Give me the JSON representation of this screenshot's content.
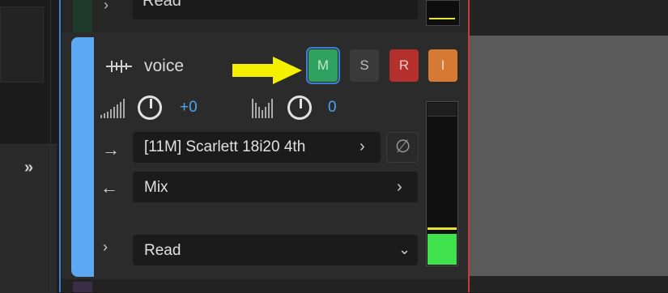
{
  "colors": {
    "track": "#5ea7f2",
    "mute_active": "#2fa25f",
    "record": "#b3302c",
    "input_monitor": "#d67a33",
    "value_text": "#4ea3f2",
    "meter_level": "#3fe24d",
    "meter_peak": "#e7e22e",
    "playhead": "#c93b3b",
    "annotation_arrow": "#f5f000"
  },
  "previous_track": {
    "automation_mode": "Read"
  },
  "track": {
    "name": "voice",
    "type_icon": "waveform-icon",
    "buttons": {
      "mute": "M",
      "solo": "S",
      "record": "R",
      "input": "I"
    },
    "mute_active": true,
    "volume": {
      "icon": "volume-icon",
      "value": "+0"
    },
    "pan": {
      "icon": "pan-icon",
      "value": "0"
    },
    "output": {
      "icon": "output-arrow-icon",
      "label": "[11M] Scarlett 18i20 4th"
    },
    "phase_icon": "phase-invert-icon",
    "input": {
      "icon": "input-arrow-icon",
      "label": "Mix"
    },
    "automation": {
      "mode": "Read"
    },
    "meter_level": 0.19
  },
  "sidebar": {
    "expand_icon": "double-chevron-right-icon",
    "expand_label": "»"
  }
}
